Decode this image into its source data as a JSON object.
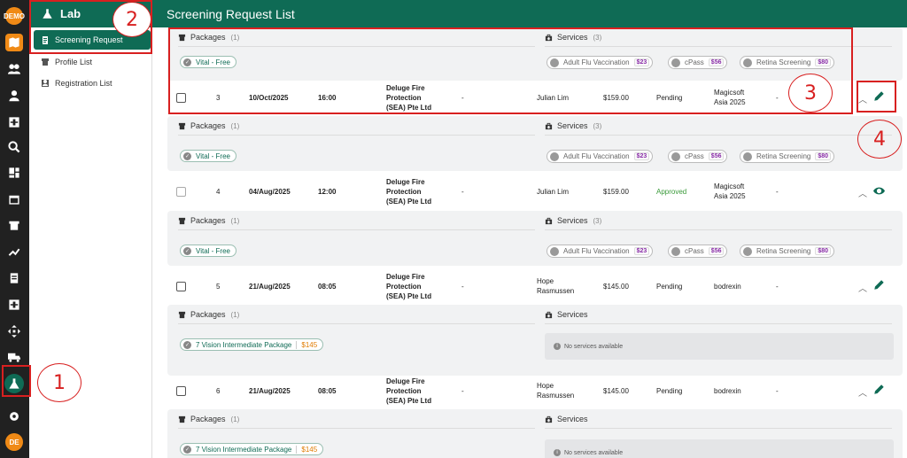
{
  "rail": {
    "demo_label": "DEMO",
    "avatar_label": "DE"
  },
  "sidebar": {
    "title": "Lab",
    "items": [
      {
        "label": "Screening Request"
      },
      {
        "label": "Profile List"
      },
      {
        "label": "Registration List"
      }
    ]
  },
  "header": {
    "title": "Screening Request List"
  },
  "labels": {
    "packages": "Packages",
    "services": "Services",
    "no_services": "No services available"
  },
  "rows": [
    {
      "no": "3",
      "date": "10/Oct/2025",
      "time": "16:00",
      "company": [
        "Deluge Fire",
        "Protection",
        "(SEA) Pte Ltd"
      ],
      "dash1": "-",
      "person": [
        "Julian Lim"
      ],
      "amount": "$159.00",
      "status": "Pending",
      "org": [
        "Magicsoft",
        "Asia 2025"
      ],
      "dash2": "-"
    },
    {
      "no": "4",
      "date": "04/Aug/2025",
      "time": "12:00",
      "company": [
        "Deluge Fire",
        "Protection",
        "(SEA) Pte Ltd"
      ],
      "dash1": "-",
      "person": [
        "Julian Lim"
      ],
      "amount": "$159.00",
      "status": "Approved",
      "org": [
        "Magicsoft",
        "Asia 2025"
      ],
      "dash2": "-"
    },
    {
      "no": "5",
      "date": "21/Aug/2025",
      "time": "08:05",
      "company": [
        "Deluge Fire",
        "Protection",
        "(SEA) Pte Ltd"
      ],
      "dash1": "-",
      "person": [
        "Hope",
        "Rasmussen"
      ],
      "amount": "$145.00",
      "status": "Pending",
      "org": [
        "bodrexin"
      ],
      "dash2": "-"
    },
    {
      "no": "6",
      "date": "21/Aug/2025",
      "time": "08:05",
      "company": [
        "Deluge Fire",
        "Protection",
        "(SEA) Pte Ltd"
      ],
      "dash1": "-",
      "person": [
        "Hope",
        "Rasmussen"
      ],
      "amount": "$145.00",
      "status": "Pending",
      "org": [
        "bodrexin"
      ],
      "dash2": "-"
    }
  ],
  "details": [
    {
      "pkg_count": "(1)",
      "svc_count": "(3)",
      "package": {
        "name": "Vital - Free",
        "price": ""
      },
      "services": [
        {
          "name": "Adult Flu Vaccination",
          "price": "$23"
        },
        {
          "name": "cPass",
          "price": "$56"
        },
        {
          "name": "Retina Screening",
          "price": "$80"
        }
      ]
    },
    {
      "pkg_count": "(1)",
      "svc_count": "(3)",
      "package": {
        "name": "Vital - Free",
        "price": ""
      },
      "services": [
        {
          "name": "Adult Flu Vaccination",
          "price": "$23"
        },
        {
          "name": "cPass",
          "price": "$56"
        },
        {
          "name": "Retina Screening",
          "price": "$80"
        }
      ]
    },
    {
      "pkg_count": "(1)",
      "svc_count": "(3)",
      "package": {
        "name": "Vital - Free",
        "price": ""
      },
      "services": [
        {
          "name": "Adult Flu Vaccination",
          "price": "$23"
        },
        {
          "name": "cPass",
          "price": "$56"
        },
        {
          "name": "Retina Screening",
          "price": "$80"
        }
      ]
    },
    {
      "pkg_count": "(1)",
      "svc_count": "",
      "package": {
        "name": "7 Vision Intermediate Package",
        "price": "$145"
      },
      "services": []
    },
    {
      "pkg_count": "(1)",
      "svc_count": "",
      "package": {
        "name": "7 Vision Intermediate Package",
        "price": "$145"
      },
      "services": []
    }
  ],
  "annotations": [
    "1",
    "2",
    "3",
    "4"
  ],
  "colors": {
    "brand": "#0f6b55",
    "accent": "#f08a16",
    "annotation": "#d82020",
    "approved": "#3a9a3a"
  }
}
